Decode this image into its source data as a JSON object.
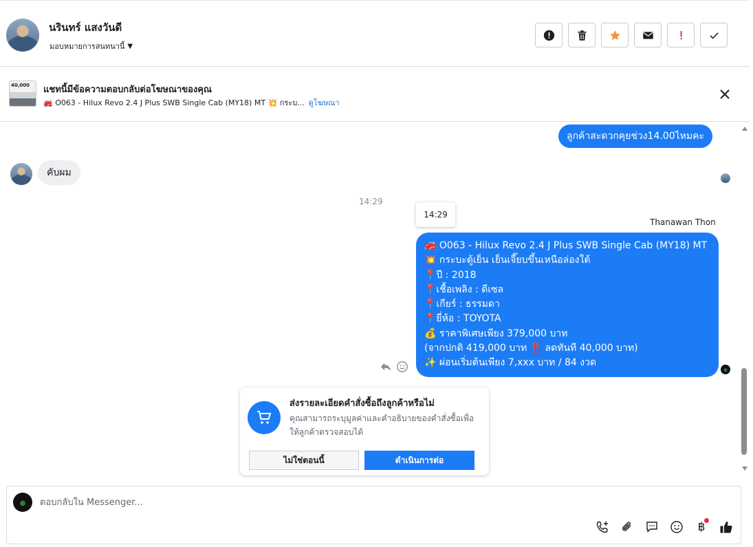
{
  "header": {
    "contact_name": "นรินทร์ แสงวันดี",
    "assign_label": "มอบหมายการสนทนานี้",
    "actions": [
      "spam-icon",
      "trash-icon",
      "star-icon",
      "mail-icon",
      "exclamation-icon",
      "check-icon"
    ]
  },
  "ad_banner": {
    "title": "แชทนี้มีข้อความตอบกลับต่อโฆษณาของคุณ",
    "subtitle": "🚒 O063 - Hilux Revo 2.4 J Plus SWB Single Cab (MY18) MT 💥 กระบ...",
    "link": "ดูโฆษณา",
    "thumb_text": "40,000"
  },
  "chat": {
    "msg_out_1": "ลูกค้าสะดวกคุยช่วง14.00ไหมคะ",
    "msg_in_1": "คับผม",
    "timestamp": "14:29",
    "tooltip_time": "14:29",
    "sender": "Thanawan Thon",
    "ad_lines": [
      "🚒 O063 - Hilux Revo 2.4 J Plus SWB Single Cab (MY18) MT",
      "💥 กระบะตู้เย็น เย็นเจี๊ยบขึ้นเหนือล่องใต้",
      "📍ปี : 2018",
      "📍เชื้อเพลิง : ดีเซล",
      "📍เกียร์ : ธรรมดา",
      "📍ยี่ห้อ : TOYOTA",
      "💰 ราคาพิเศษเพียง 379,000 บาท",
      "(จากปกติ 419,000 บาท ‼️ ลดทันที 40,000 บาท)",
      "✨ ผ่อนเริ่มต้นเพียง 7,xxx บาท / 84 งวด"
    ]
  },
  "order_card": {
    "title": "ส่งรายละเอียดคำสั่งซื้อถึงลูกค้าหรือไม่",
    "description": "คุณสามารถระบุมูลค่าและคำอธิบายของคำสั่งซื้อเพื่อให้ลูกค้าตรวจสอบได้",
    "no_button": "ไม่ใช่ตอนนี้",
    "continue_button": "ดำเนินการต่อ"
  },
  "composer": {
    "placeholder": "ตอบกลับใน Messenger...",
    "baht_symbol": "฿"
  },
  "colors": {
    "accent": "#1b7cf6",
    "star": "#f7923b",
    "warning": "#e41e3f"
  }
}
